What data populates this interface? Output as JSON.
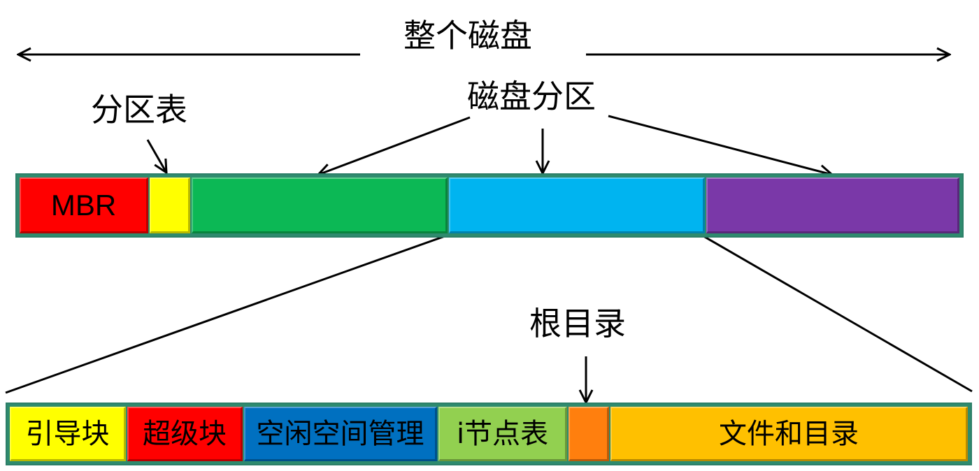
{
  "labels": {
    "whole_disk": "整个磁盘",
    "partition_table": "分区表",
    "disk_partition": "磁盘分区",
    "root_directory": "根目录"
  },
  "disk_bar": {
    "segments": [
      {
        "name": "mbr",
        "text": "MBR",
        "color": "#ff0000"
      },
      {
        "name": "partition-table",
        "text": "",
        "color": "#ffff00"
      },
      {
        "name": "partition-1",
        "text": "",
        "color": "#0cb855"
      },
      {
        "name": "partition-2",
        "text": "",
        "color": "#00b4f0"
      },
      {
        "name": "partition-3",
        "text": "",
        "color": "#7a38a8"
      }
    ]
  },
  "partition_bar": {
    "segments": [
      {
        "name": "boot-block",
        "text": "引导块",
        "color": "#ffff00"
      },
      {
        "name": "super-block",
        "text": "超级块",
        "color": "#ff0000"
      },
      {
        "name": "free-space-management",
        "text": "空闲空间管理",
        "color": "#0070c0"
      },
      {
        "name": "inode-table",
        "text": "i节点表",
        "color": "#92d050"
      },
      {
        "name": "root-directory",
        "text": "",
        "color": "#ff7f0e"
      },
      {
        "name": "files-and-directories",
        "text": "文件和目录",
        "color": "#ffc000"
      }
    ]
  }
}
